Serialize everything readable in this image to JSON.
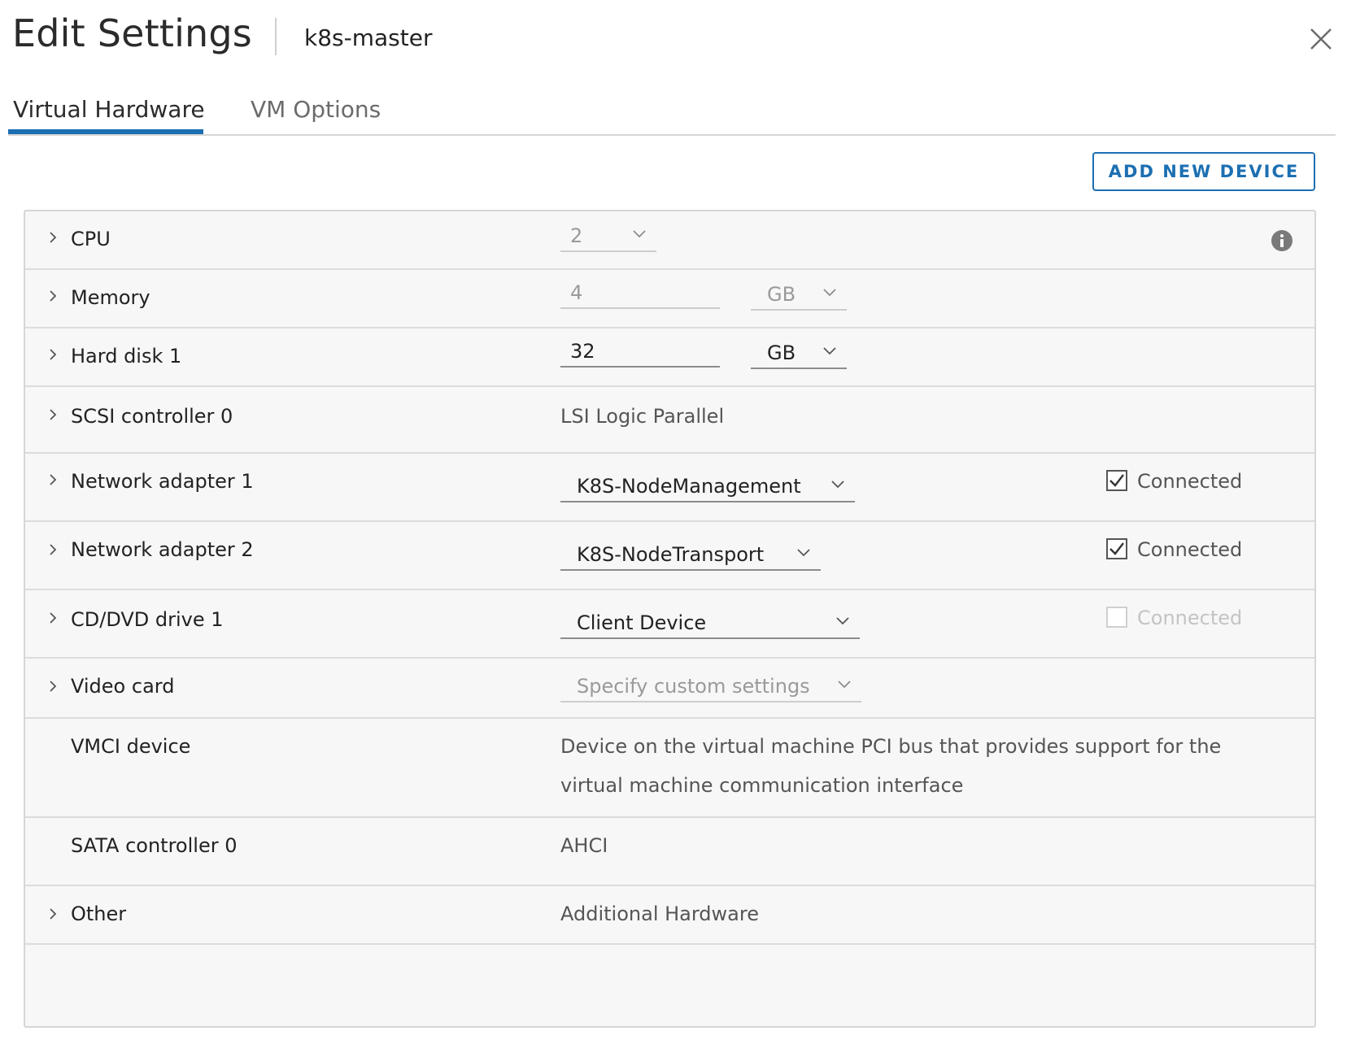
{
  "header": {
    "title": "Edit Settings",
    "vm_name": "k8s-master"
  },
  "tabs": [
    {
      "label": "Virtual Hardware",
      "active": true
    },
    {
      "label": "VM Options",
      "active": false
    }
  ],
  "toolbar": {
    "add_device_label": "ADD NEW DEVICE"
  },
  "colors": {
    "accent": "#1c6fb2",
    "row_bg": "#f7f7f7",
    "border": "#d6d6d6"
  },
  "devices": {
    "cpu": {
      "label": "CPU",
      "value": "2"
    },
    "memory": {
      "label": "Memory",
      "value": "4",
      "unit": "GB"
    },
    "hard_disk": {
      "label": "Hard disk 1",
      "value": "32",
      "unit": "GB"
    },
    "scsi": {
      "label": "SCSI controller 0",
      "value": "LSI Logic Parallel"
    },
    "net1": {
      "label": "Network adapter 1",
      "value": "K8S-NodeManagement",
      "connected_label": "Connected",
      "connected": true
    },
    "net2": {
      "label": "Network adapter 2",
      "value": "K8S-NodeTransport",
      "connected_label": "Connected",
      "connected": true
    },
    "cd": {
      "label": "CD/DVD drive 1",
      "value": "Client Device",
      "connected_label": "Connected",
      "connected": false
    },
    "video": {
      "label": "Video card",
      "value": "Specify custom settings"
    },
    "vmci": {
      "label": "VMCI device",
      "description_line1": "Device on the virtual machine PCI bus that provides support for the",
      "description_line2": "virtual machine communication interface"
    },
    "sata": {
      "label": "SATA controller 0",
      "value": "AHCI"
    },
    "other": {
      "label": "Other",
      "value": "Additional Hardware"
    }
  }
}
